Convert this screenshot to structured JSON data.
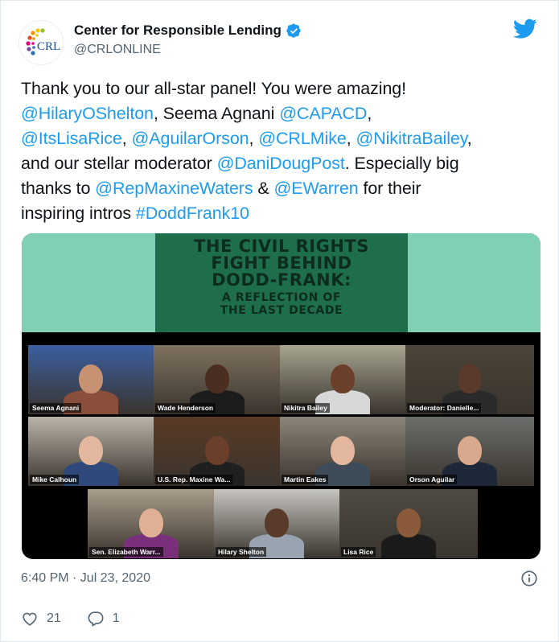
{
  "author": {
    "display_name": "Center for Responsible Lending",
    "handle": "@CRLONLINE",
    "avatar_text": "CRL"
  },
  "tweet": {
    "segments": [
      {
        "t": "Thank you to our all-star panel! You were amazing!\n",
        "link": false
      },
      {
        "t": "@HilaryOShelton",
        "link": true
      },
      {
        "t": ", Seema Agnani ",
        "link": false
      },
      {
        "t": "@CAPACD",
        "link": true
      },
      {
        "t": ",\n",
        "link": false
      },
      {
        "t": "@ItsLisaRice",
        "link": true
      },
      {
        "t": ", ",
        "link": false
      },
      {
        "t": "@AguilarOrson",
        "link": true
      },
      {
        "t": ", ",
        "link": false
      },
      {
        "t": "@CRLMike",
        "link": true
      },
      {
        "t": ", ",
        "link": false
      },
      {
        "t": "@NikitraBailey",
        "link": true
      },
      {
        "t": ",\nand our stellar moderator ",
        "link": false
      },
      {
        "t": "@DaniDougPost",
        "link": true
      },
      {
        "t": ". Especially big\nthanks to ",
        "link": false
      },
      {
        "t": "@RepMaxineWaters",
        "link": true
      },
      {
        "t": " & ",
        "link": false
      },
      {
        "t": "@EWarren",
        "link": true
      },
      {
        "t": " for their\ninspiring intros ",
        "link": false
      },
      {
        "t": "#DoddFrank10",
        "link": true
      }
    ]
  },
  "media": {
    "poster_title": "THE CIVIL RIGHTS\nFIGHT BEHIND\nDODD-FRANK:",
    "poster_subtitle": "A REFLECTION OF\nTHE LAST DECADE",
    "participants": [
      {
        "name": "Seema Agnani"
      },
      {
        "name": "Wade Henderson"
      },
      {
        "name": "Nikitra Bailey"
      },
      {
        "name": "Moderator: Danielle..."
      },
      {
        "name": "Mike Calhoun"
      },
      {
        "name": "U.S. Rep. Maxine Wa..."
      },
      {
        "name": "Martin Eakes"
      },
      {
        "name": "Orson Aguilar"
      },
      {
        "name": "Sen. Elizabeth Warr..."
      },
      {
        "name": "Hilary Shelton"
      },
      {
        "name": "Lisa Rice"
      }
    ]
  },
  "timestamp": "6:40 PM · Jul 23, 2020",
  "actions": {
    "likes": "21",
    "replies": "1"
  },
  "colors": {
    "link": "#1d9bf0",
    "muted": "#536471",
    "poster_bg": "#1f6e4b",
    "media_band": "#7fd0b4",
    "active_speaker": "#7be23a"
  }
}
